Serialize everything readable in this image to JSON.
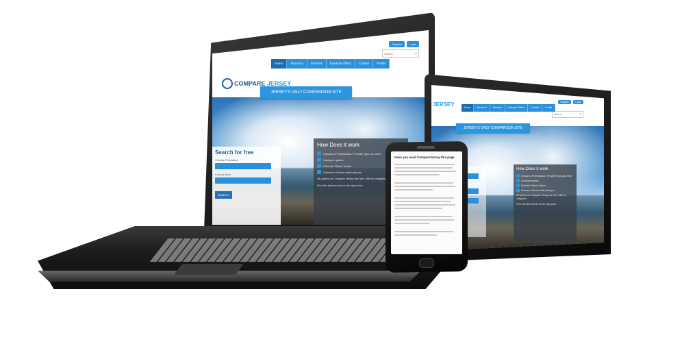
{
  "site": {
    "logo_compare": "COMPARE",
    "logo_jersey": "JERSEY",
    "top_buttons": [
      "Register",
      "Login"
    ],
    "search_placeholder": "Search",
    "nav": [
      "Home",
      "About Us",
      "Services",
      "Example Offers",
      "Contact",
      "Profile"
    ],
    "banner": "JERSEY'S ONLY COMPARISON SITE",
    "search_panel": {
      "title": "Search for free",
      "field1_label": "Choose Profession",
      "field2_label": "Choose Area",
      "button": "SEARCH"
    },
    "how_panel": {
      "title": "How Does it work",
      "steps": [
        "Choose a Professional / Provider type you need",
        "Compare quotes",
        "Click the 'Select' button",
        "Choose a Service that suits you"
      ],
      "text1": "All quotes on Compare Jersey are free, with no obligation",
      "text2": "Find the best service at the right price"
    }
  },
  "phone": {
    "heading": "Have you used CompareJersey this page"
  },
  "colors": {
    "brand_blue": "#2b96e0",
    "logo_blue": "#1d5fa0",
    "device_black": "#0c0c0c"
  }
}
